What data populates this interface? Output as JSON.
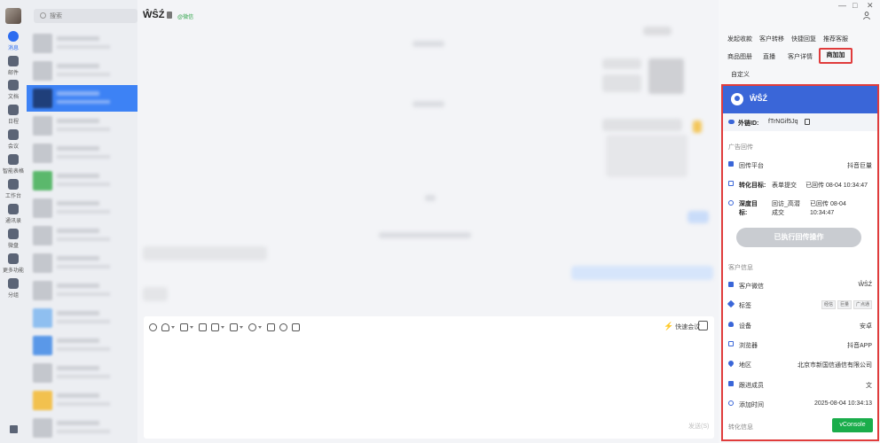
{
  "rail": {
    "items": [
      {
        "label": "消息",
        "icon": "chat-bubble-icon"
      },
      {
        "label": "邮件",
        "icon": "mail-icon"
      },
      {
        "label": "文档",
        "icon": "document-icon"
      },
      {
        "label": "日程",
        "icon": "calendar-icon"
      },
      {
        "label": "会议",
        "icon": "video-meeting-icon"
      },
      {
        "label": "智能表格",
        "icon": "smart-sheet-icon"
      },
      {
        "label": "工作台",
        "icon": "workbench-icon"
      },
      {
        "label": "通讯录",
        "icon": "contacts-icon"
      },
      {
        "label": "微盘",
        "icon": "cloud-drive-icon"
      },
      {
        "label": "更多功能",
        "icon": "more-features-icon"
      },
      {
        "label": "分组",
        "icon": "group-icon"
      }
    ]
  },
  "search": {
    "placeholder": "搜索"
  },
  "chat": {
    "title": "ŴŜŹ",
    "source_tag": "@微信",
    "quick_meeting": "快速会议",
    "send_label": "发送(S)"
  },
  "window": {
    "minimize": "—",
    "maximize": "□",
    "close": "✕"
  },
  "right_panel": {
    "tabs_row1": [
      "发起收款",
      "客户转移",
      "快捷回复",
      "推荐客服"
    ],
    "tabs_row2": [
      "商品图册",
      "直播",
      "客户详情"
    ],
    "active_tab": "商加加",
    "tab_row3": "自定义",
    "card": {
      "name": "ŴŜŹ",
      "ext_id_label": "外链ID:",
      "ext_id_value": "fTrNGif5Jq",
      "ad_section": "广告回传",
      "platform_label": "回传平台",
      "platform_value": "抖音巨量",
      "convert_label": "转化目标:",
      "convert_type": "表单提交",
      "convert_status": "已回传 08-04 10:34:47",
      "deep_label": "深度目标:",
      "deep_type": "回访_高潜成交",
      "deep_status": "已回传 08-04 10:34:47",
      "exec_button": "已执行回传操作",
      "cust_section": "客户信息",
      "wechat_label": "客户微信",
      "wechat_value": "ŴŜŹ",
      "tags_label": "标签",
      "tags": [
        "经信",
        "巨量",
        "广点通"
      ],
      "device_label": "设备",
      "device_value": "安卓",
      "browser_label": "浏览器",
      "browser_value": "抖音APP",
      "region_label": "地区",
      "region_value": "北京市新国信通信有限公司",
      "follower_label": "跟进成员",
      "follower_value": "文",
      "added_label": "添加时间",
      "added_value": "2025-08-04 10:34:13",
      "conv_section": "转化信息"
    },
    "vconsole": "vConsole"
  },
  "colors": {
    "accent": "#2c6cf0",
    "highlight": "#e03c3c",
    "card_header": "#3a66d8",
    "vconsole": "#1aad4b"
  }
}
